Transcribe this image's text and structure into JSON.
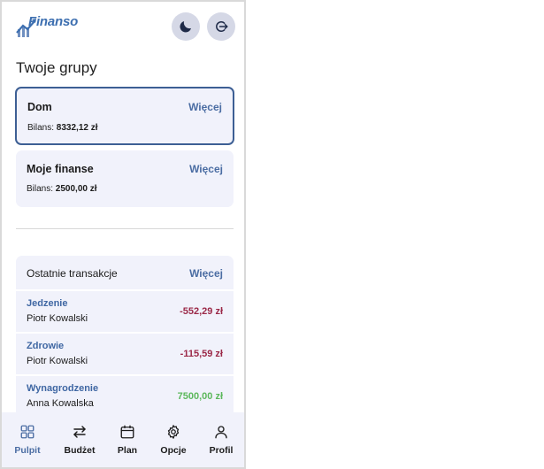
{
  "app": {
    "name": "Finanso"
  },
  "colors": {
    "accent": "#4b6da3",
    "negative": "#9b2948",
    "positive": "#5cb85c",
    "card_bg": "#f1f2fb"
  },
  "header": {
    "theme_icon": "moon-icon",
    "logout_icon": "logout-icon"
  },
  "groups": {
    "title": "Twoje grupy",
    "items": [
      {
        "name": "Dom",
        "more_label": "Więcej",
        "balance_label": "Bilans:",
        "balance_value": "8332,12 zł",
        "selected": true
      },
      {
        "name": "Moje finanse",
        "more_label": "Więcej",
        "balance_label": "Bilans:",
        "balance_value": "2500,00 zł",
        "selected": false
      }
    ]
  },
  "transactions": {
    "title": "Ostatnie transakcje",
    "more_label": "Więcej",
    "items": [
      {
        "category": "Jedzenie",
        "person": "Piotr Kowalski",
        "amount": "-552,29 zł",
        "type": "negative"
      },
      {
        "category": "Zdrowie",
        "person": "Piotr Kowalski",
        "amount": "-115,59 zł",
        "type": "negative"
      },
      {
        "category": "Wynagrodzenie",
        "person": "Anna Kowalska",
        "amount": "7500,00 zł",
        "type": "positive"
      }
    ]
  },
  "nav": {
    "items": [
      {
        "label": "Pulpit",
        "icon": "grid-icon",
        "active": true
      },
      {
        "label": "Budżet",
        "icon": "swap-arrows-icon",
        "active": false
      },
      {
        "label": "Plan",
        "icon": "calendar-icon",
        "active": false
      },
      {
        "label": "Opcje",
        "icon": "gear-icon",
        "active": false
      },
      {
        "label": "Profil",
        "icon": "user-icon",
        "active": false
      }
    ]
  }
}
